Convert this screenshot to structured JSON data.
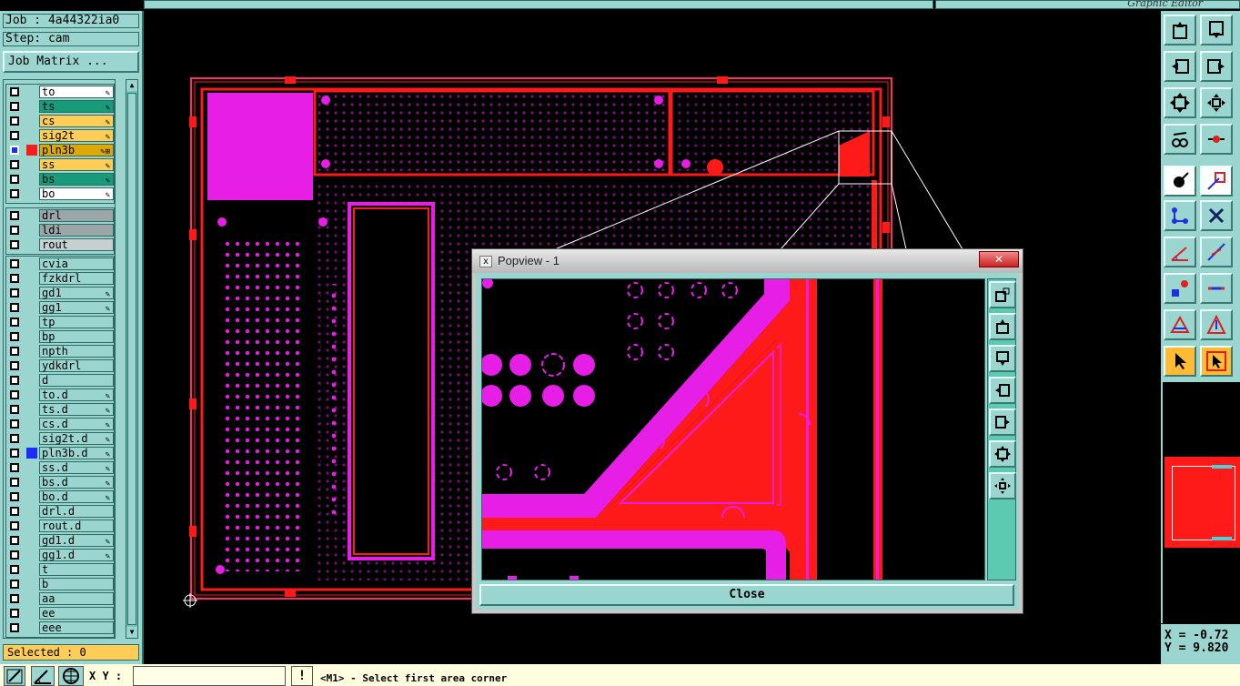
{
  "job": {
    "job_label": "Job : 4a44322ia0",
    "step_label": "Step: cam",
    "matrix_button": "Job Matrix ..."
  },
  "layers": {
    "board": [
      {
        "name": "to",
        "color": "#ffffff",
        "edit": "✎"
      },
      {
        "name": "ts",
        "color": "#169c7a",
        "edit": "✎"
      },
      {
        "name": "cs",
        "color": "#ffcc55",
        "edit": "✎"
      },
      {
        "name": "sig2t",
        "color": "#ffcc55",
        "edit": "✎"
      },
      {
        "name": "pln3b",
        "color": "#e0a800",
        "edit": "✎⊞",
        "active": true
      },
      {
        "name": "ss",
        "color": "#ffcc55",
        "edit": "✎"
      },
      {
        "name": "bs",
        "color": "#169c7a",
        "edit": "✎"
      },
      {
        "name": "bo",
        "color": "#ffffff",
        "edit": "✎"
      }
    ],
    "drill": [
      {
        "name": "drl",
        "color": "#9aa6a8",
        "edit": ""
      },
      {
        "name": "ldi",
        "color": "#9aa6a8",
        "edit": ""
      },
      {
        "name": "rout",
        "color": "#c8cfd0",
        "edit": ""
      }
    ],
    "misc": [
      {
        "name": "cvia",
        "edit": ""
      },
      {
        "name": "fzkdrl",
        "edit": ""
      },
      {
        "name": "gd1",
        "edit": "✎"
      },
      {
        "name": "gg1",
        "edit": "✎"
      },
      {
        "name": "tp",
        "edit": ""
      },
      {
        "name": "bp",
        "edit": ""
      },
      {
        "name": "npth",
        "edit": ""
      },
      {
        "name": "ydkdrl",
        "edit": ""
      },
      {
        "name": "d",
        "edit": ""
      },
      {
        "name": "to.d",
        "edit": "✎"
      },
      {
        "name": "ts.d",
        "edit": "✎"
      },
      {
        "name": "cs.d",
        "edit": "✎"
      },
      {
        "name": "sig2t.d",
        "edit": "✎"
      },
      {
        "name": "pln3b.d",
        "edit": "✎",
        "marker": "#1a2cff"
      },
      {
        "name": "ss.d",
        "edit": "✎"
      },
      {
        "name": "bs.d",
        "edit": "✎"
      },
      {
        "name": "bo.d",
        "edit": "✎"
      },
      {
        "name": "drl.d",
        "edit": ""
      },
      {
        "name": "rout.d",
        "edit": ""
      },
      {
        "name": "gd1.d",
        "edit": "✎"
      },
      {
        "name": "gg1.d",
        "edit": "✎"
      },
      {
        "name": "t",
        "edit": ""
      },
      {
        "name": "b",
        "edit": ""
      },
      {
        "name": "aa",
        "edit": ""
      },
      {
        "name": "ee",
        "edit": ""
      },
      {
        "name": "eee",
        "edit": ""
      }
    ]
  },
  "selected_label": "Selected : 0",
  "top_title": "Graphic Editor",
  "popview": {
    "title": "Popview - 1",
    "close_x": "✕",
    "close_button": "Close"
  },
  "coords": {
    "x_label": "X = -0.72",
    "y_label": "Y = 9.820"
  },
  "bottombar": {
    "xy_label": "X Y :",
    "xy_value": "",
    "bang": "!",
    "status": "<M1> - Select first area corner"
  },
  "colors": {
    "panel": "#9ad6cf",
    "pcb_magenta": "#e61ee6",
    "pcb_red": "#ff1a1a",
    "outline": "#ff2a6a"
  }
}
